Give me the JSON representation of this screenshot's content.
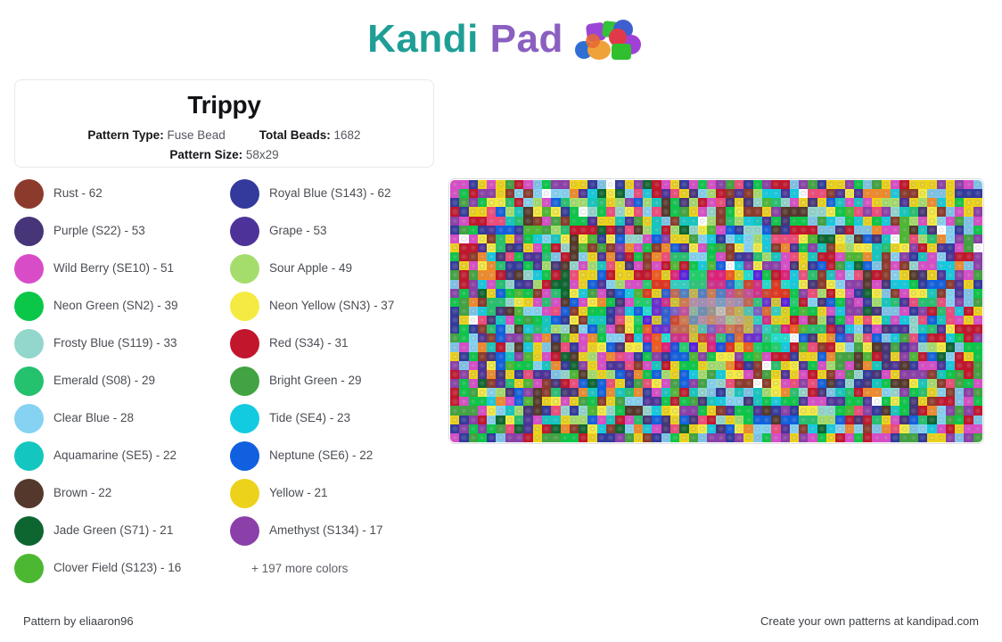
{
  "header": {
    "logo_text_part1": "Kandi",
    "logo_text_part2": "Pad",
    "logo_icon": "kandi-beads-cluster-icon",
    "brand_teal": "#1f9e96",
    "brand_purple": "#8a5fc0"
  },
  "info": {
    "title": "Trippy",
    "pattern_type_label": "Pattern Type:",
    "pattern_type_value": "Fuse Bead",
    "total_beads_label": "Total Beads:",
    "total_beads_value": "1682",
    "pattern_size_label": "Pattern Size:",
    "pattern_size_value": "58x29"
  },
  "legend": {
    "items": [
      {
        "name": "Rust - 62",
        "color": "#8c3a2b"
      },
      {
        "name": "Royal Blue (S143) - 62",
        "color": "#333a9c"
      },
      {
        "name": "Purple (S22) - 53",
        "color": "#463578"
      },
      {
        "name": "Grape - 53",
        "color": "#4d3399"
      },
      {
        "name": "Wild Berry (SE10) - 51",
        "color": "#d94cc8"
      },
      {
        "name": "Sour Apple - 49",
        "color": "#a5dd6d"
      },
      {
        "name": "Neon Green (SN2) - 39",
        "color": "#0ac748"
      },
      {
        "name": "Neon Yellow (SN3) - 37",
        "color": "#f4ea42"
      },
      {
        "name": "Frosty Blue (S119) - 33",
        "color": "#93d6cc"
      },
      {
        "name": "Red (S34) - 31",
        "color": "#c2162c"
      },
      {
        "name": "Emerald (S08) - 29",
        "color": "#24c16e"
      },
      {
        "name": "Bright Green - 29",
        "color": "#41a341"
      },
      {
        "name": "Clear Blue - 28",
        "color": "#85d2f2"
      },
      {
        "name": "Tide (SE4) - 23",
        "color": "#12cbe0"
      },
      {
        "name": "Aquamarine (SE5) - 22",
        "color": "#13c7c0"
      },
      {
        "name": "Neptune (SE6) - 22",
        "color": "#1160e0"
      },
      {
        "name": "Brown - 22",
        "color": "#55382c"
      },
      {
        "name": "Yellow - 21",
        "color": "#ecd21a"
      },
      {
        "name": "Jade Green (S71) - 21",
        "color": "#0d6630"
      },
      {
        "name": "Amethyst (S134) - 17",
        "color": "#8b3fa8"
      },
      {
        "name": "Clover Field (S123) - 16",
        "color": "#4cb832"
      }
    ],
    "more_colors": "+ 197 more colors"
  },
  "pattern": {
    "name": "trippy-bead-pattern-preview",
    "cols": 58,
    "rows": 29,
    "palette": [
      "#8c3a2b",
      "#333a9c",
      "#463578",
      "#4d3399",
      "#d94cc8",
      "#a5dd6d",
      "#0ac748",
      "#f4ea42",
      "#93d6cc",
      "#c2162c",
      "#24c16e",
      "#41a341",
      "#85d2f2",
      "#12cbe0",
      "#13c7c0",
      "#1160e0",
      "#55382c",
      "#ecd21a",
      "#0d6630",
      "#8b3fa8",
      "#4cb832",
      "#f08a2a",
      "#ef4b7a",
      "#7ec4e8",
      "#b8e0a0",
      "#e85d2f",
      "#9a7bd6",
      "#3c3c3c",
      "#f5a6c9",
      "#d4c98a"
    ],
    "center_palette": [
      "#b0aca4",
      "#9a958c",
      "#8e8a84",
      "#bdb9b2",
      "#a39d94",
      "#c4bfb6",
      "#7f7b75",
      "#b8ada0",
      "#cfc7ba",
      "#968f86"
    ],
    "ring_palettes": [
      [
        "#b0aca4",
        "#9a958c",
        "#8e8a84",
        "#bdb9b2",
        "#a39d94",
        "#c4bfb6",
        "#7f7b75",
        "#b8ada0"
      ],
      [
        "#6b8fb5",
        "#c98a6a",
        "#8fb5a0",
        "#b58fa8",
        "#7a9ec4",
        "#c4a98f",
        "#9f8fb5",
        "#a8c48f"
      ],
      [
        "#4f7fc4",
        "#d07a4f",
        "#4fb58a",
        "#c44f9a",
        "#7a5fc4",
        "#c4b54f",
        "#4fc4b5",
        "#c4664f"
      ],
      [
        "#2f5fd0",
        "#e06a2f",
        "#2fc47a",
        "#d02f8a",
        "#6a2fd0",
        "#d0c42f",
        "#2fd0c4",
        "#d0452f"
      ],
      [
        "#1f4fe0",
        "#f05a1f",
        "#1fd06a",
        "#e01f7a",
        "#5a1fe0",
        "#e0d01f",
        "#1fe0d0",
        "#e0351f"
      ],
      [
        "#0ac748",
        "#f4ea42",
        "#d94cc8",
        "#12cbe0",
        "#1160e0",
        "#c2162c",
        "#8b3fa8",
        "#4cb832"
      ],
      [
        "#333a9c",
        "#8c3a2b",
        "#463578",
        "#a5dd6d",
        "#24c16e",
        "#85d2f2",
        "#ecd21a",
        "#ef4b7a"
      ],
      [
        "#d94cc8",
        "#0ac748",
        "#f4ea42",
        "#1160e0",
        "#c2162c",
        "#13c7c0",
        "#f08a2a",
        "#4d3399"
      ],
      [
        "#85d2f2",
        "#41a341",
        "#8b3fa8",
        "#ecd21a",
        "#12cbe0",
        "#8c3a2b",
        "#a5dd6d",
        "#d94cc8"
      ],
      [
        "#0d6630",
        "#4cb832",
        "#333a9c",
        "#f4ea42",
        "#ef4b7a",
        "#55382c",
        "#93d6cc",
        "#1160e0"
      ],
      [
        "#c2162c",
        "#13c7c0",
        "#d94cc8",
        "#a5dd6d",
        "#463578",
        "#f08a2a",
        "#24c16e",
        "#7ec4e8"
      ],
      [
        "#4d3399",
        "#ecd21a",
        "#0ac748",
        "#85d2f2",
        "#8c3a2b",
        "#d94cc8",
        "#41a341",
        "#12cbe0"
      ],
      [
        "#f4ea42",
        "#333a9c",
        "#4cb832",
        "#ef4b7a",
        "#93d6cc",
        "#55382c",
        "#8b3fa8",
        "#0ac748"
      ],
      [
        "#1160e0",
        "#a5dd6d",
        "#c2162c",
        "#13c7c0",
        "#d94cc8",
        "#ecd21a",
        "#463578",
        "#24c16e"
      ],
      [
        "#8c3a2b",
        "#85d2f2",
        "#f08a2a",
        "#0d6630",
        "#4d3399",
        "#f4ea42",
        "#ef4b7a",
        "#12cbe0"
      ],
      [
        "#0ac748",
        "#d94cc8",
        "#333a9c",
        "#ecd21a",
        "#41a341",
        "#c2162c",
        "#7ec4e8",
        "#8b3fa8"
      ]
    ]
  },
  "footer": {
    "left": "Pattern by eliaaron96",
    "right": "Create your own patterns at kandipad.com"
  }
}
